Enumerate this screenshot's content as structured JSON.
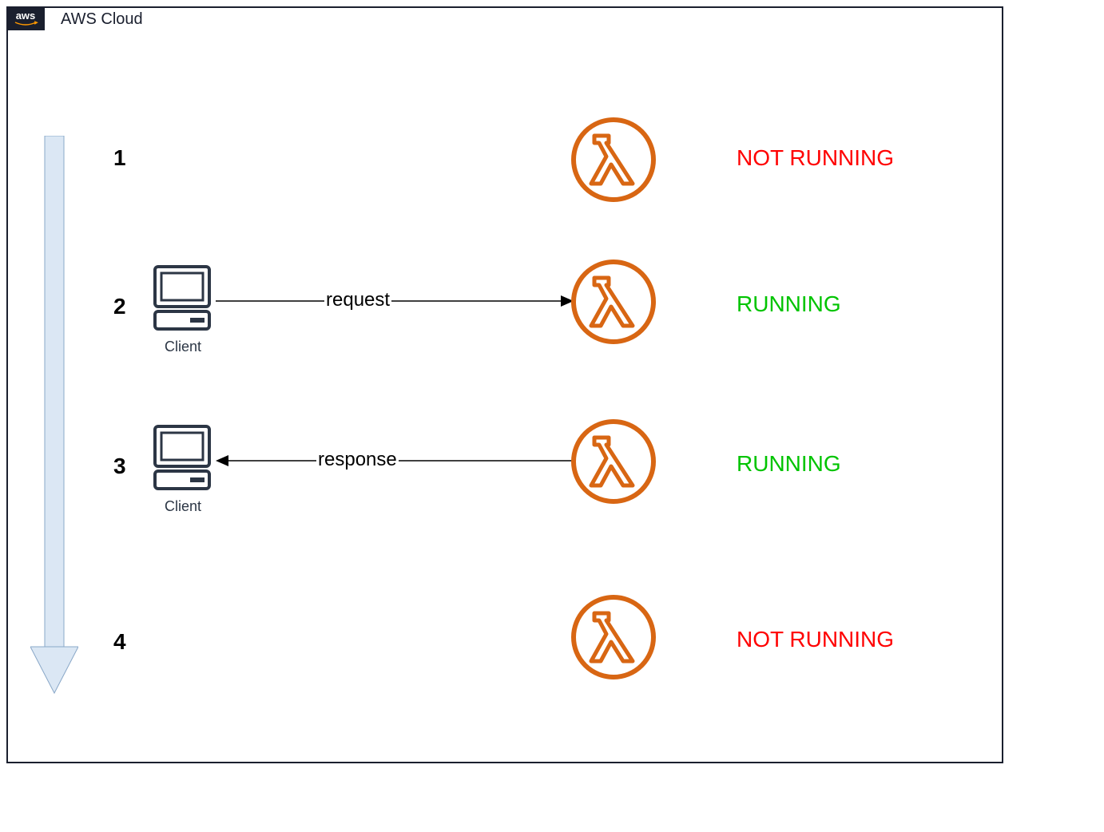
{
  "cloud_label": "AWS Cloud",
  "aws_logo_text": "aws",
  "steps": [
    {
      "num": "1",
      "status": "NOT RUNNING",
      "status_color": "red",
      "has_client": false,
      "client_label": "",
      "arrow_label": "",
      "arrow_dir": ""
    },
    {
      "num": "2",
      "status": "RUNNING",
      "status_color": "green",
      "has_client": true,
      "client_label": "Client",
      "arrow_label": "request",
      "arrow_dir": "right"
    },
    {
      "num": "3",
      "status": "RUNNING",
      "status_color": "green",
      "has_client": true,
      "client_label": "Client",
      "arrow_label": "response",
      "arrow_dir": "left"
    },
    {
      "num": "4",
      "status": "NOT RUNNING",
      "status_color": "red",
      "has_client": false,
      "client_label": "",
      "arrow_label": "",
      "arrow_dir": ""
    }
  ]
}
